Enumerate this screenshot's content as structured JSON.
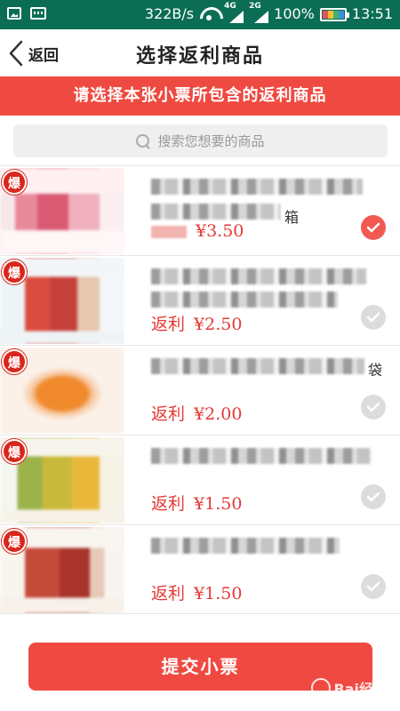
{
  "status_bar": {
    "speed": "322B/s",
    "net1": "4G",
    "net2": "2G",
    "battery": "100%",
    "time": "13:51",
    "icons": [
      "image-icon",
      "keyboard-icon",
      "wifi-icon",
      "signal-icon",
      "battery-icon"
    ]
  },
  "nav": {
    "back_label": "返回",
    "title": "选择返利商品"
  },
  "banner": "请选择本张小票所包含的返利商品",
  "search": {
    "placeholder": "搜索您想要的商品"
  },
  "products": [
    {
      "badge": "爆",
      "rebate_label": "",
      "price": "¥3.50",
      "tail": "箱",
      "selected": true
    },
    {
      "badge": "爆",
      "rebate_label": "返利",
      "price": "¥2.50",
      "tail": "",
      "selected": false
    },
    {
      "badge": "爆",
      "rebate_label": "返利",
      "price": "¥2.00",
      "tail": "袋",
      "selected": false
    },
    {
      "badge": "爆",
      "rebate_label": "返利",
      "price": "¥1.50",
      "tail": "",
      "selected": false
    },
    {
      "badge": "爆",
      "rebate_label": "返利",
      "price": "¥1.50",
      "tail": "",
      "selected": false
    }
  ],
  "submit_label": "提交小票",
  "watermark": "Bai经验",
  "colors": {
    "status_bar": "#0b6e54",
    "accent": "#ef4a41",
    "price": "#e53935",
    "check_off": "#dcdcdc"
  }
}
